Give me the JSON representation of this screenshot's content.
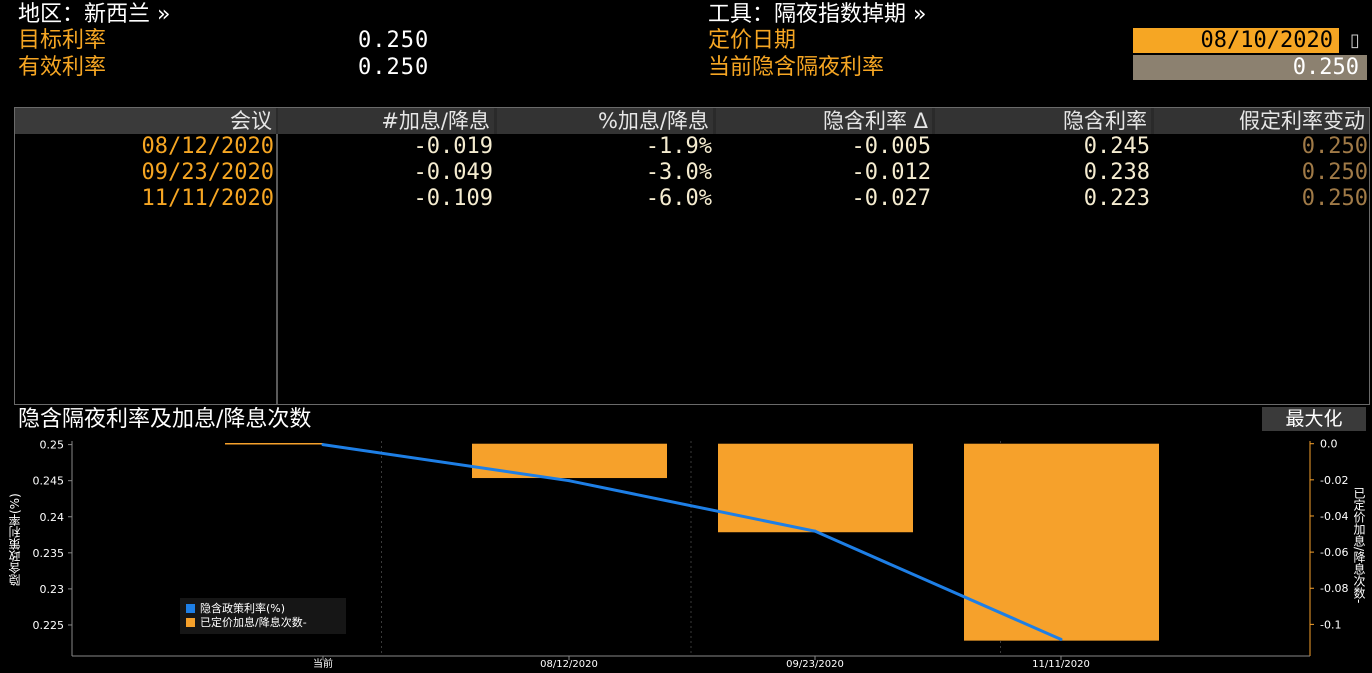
{
  "header": {
    "region_label": "地区：新西兰 »",
    "tool_label": "工具：隔夜指数掉期 »",
    "target_rate_label": "目标利率",
    "target_rate_value": "0.250",
    "effective_rate_label": "有效利率",
    "effective_rate_value": "0.250",
    "pricing_date_label": "定价日期",
    "pricing_date_value": "08/10/2020",
    "implied_overnight_label": "当前隐含隔夜利率",
    "implied_overnight_value": "0.250",
    "calendar_icon": "calendar-icon"
  },
  "table": {
    "columns": [
      "会议",
      "#加息/降息",
      "%加息/降息",
      "隐含利率 Δ",
      "隐含利率",
      "假定利率变动"
    ],
    "rows": [
      {
        "meeting": "08/12/2020",
        "hikes": "-0.019",
        "pct": "-1.9%",
        "delta": "-0.005",
        "rate": "0.245",
        "assumed": "0.250"
      },
      {
        "meeting": "09/23/2020",
        "hikes": "-0.049",
        "pct": "-3.0%",
        "delta": "-0.012",
        "rate": "0.238",
        "assumed": "0.250"
      },
      {
        "meeting": "11/11/2020",
        "hikes": "-0.109",
        "pct": "-6.0%",
        "delta": "-0.027",
        "rate": "0.223",
        "assumed": "0.250"
      }
    ]
  },
  "chart_section": {
    "title": "隐含隔夜利率及加息/降息次数",
    "maximize_label": "最大化"
  },
  "chart_data": {
    "type": "bar",
    "categories": [
      "当前",
      "08/12/2020",
      "09/23/2020",
      "11/11/2020"
    ],
    "series": [
      {
        "name": "隐含政策利率(%)",
        "type": "line",
        "axis": "left",
        "color": "#1e7fe6",
        "values": [
          0.25,
          0.245,
          0.238,
          0.223
        ]
      },
      {
        "name": "已定价加息/降息次数-",
        "type": "bar",
        "axis": "right",
        "color": "#f6a12b",
        "values": [
          0,
          -0.019,
          -0.049,
          -0.109
        ]
      }
    ],
    "ylabel": "隐含政策利率(%)",
    "y2label": "已定价加息/降息次数-",
    "ylim": [
      0.2207,
      0.2505
    ],
    "y2lim": [
      -0.1175,
      0.0015
    ],
    "yticks": [
      0.25,
      0.245,
      0.24,
      0.235,
      0.23,
      0.225
    ],
    "ytick_labels": [
      "0.25",
      "0.245",
      "0.24",
      "0.235",
      "0.23",
      "0.225"
    ],
    "y2ticks": [
      0,
      -0.02,
      -0.04,
      -0.06,
      -0.08,
      -0.1
    ],
    "y2tick_labels": [
      "0.0",
      "-0.02",
      "-0.04",
      "-0.06",
      "-0.08",
      "-0.1"
    ],
    "legend_position": "bottom-left",
    "grid": true
  },
  "colors": {
    "accent_orange": "#f6a623",
    "line_blue": "#1e7fe6",
    "bar_orange": "#f6a12b"
  }
}
